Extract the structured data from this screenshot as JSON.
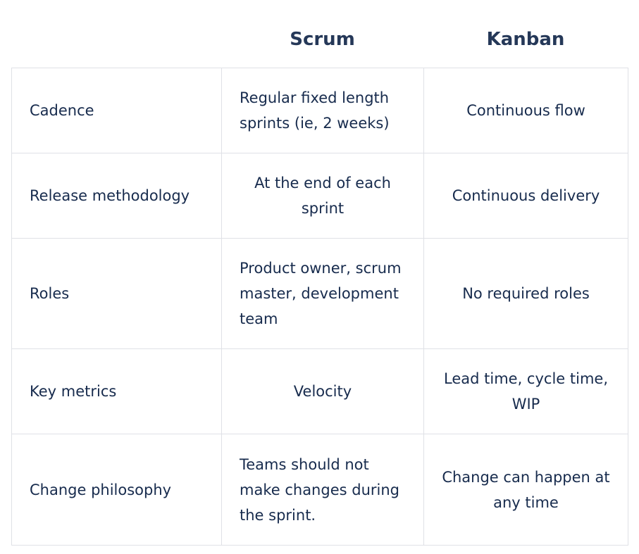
{
  "header": {
    "scrum": "Scrum",
    "kanban": "Kanban"
  },
  "rows": [
    {
      "label": "Cadence",
      "scrum": "Regular fixed length sprints (ie, 2 weeks)",
      "kanban": "Continuous flow"
    },
    {
      "label": "Release methodology",
      "scrum": "At the end of each sprint",
      "kanban": "Continuous delivery"
    },
    {
      "label": "Roles",
      "scrum": "Product owner, scrum master, development team",
      "kanban": "No required roles"
    },
    {
      "label": "Key metrics",
      "scrum": "Velocity",
      "kanban": "Lead time, cycle time, WIP"
    },
    {
      "label": "Change philosophy",
      "scrum": "Teams should not make changes during the sprint.",
      "kanban": "Change can happen at any time"
    }
  ]
}
